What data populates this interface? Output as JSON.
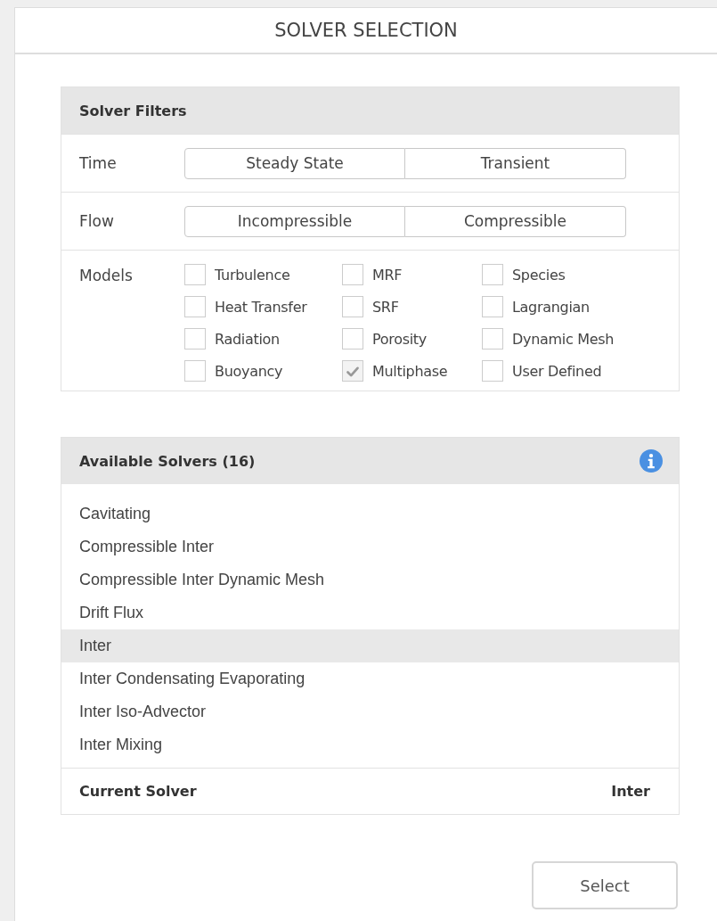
{
  "window": {
    "title": "SOLVER SELECTION"
  },
  "filters": {
    "title": "Solver Filters",
    "rows": [
      {
        "label": "Time",
        "options": [
          {
            "label": "Steady State",
            "selected": false
          },
          {
            "label": "Transient",
            "selected": false
          }
        ]
      },
      {
        "label": "Flow",
        "options": [
          {
            "label": "Incompressible",
            "selected": false
          },
          {
            "label": "Compressible",
            "selected": false
          }
        ]
      }
    ],
    "models": {
      "label": "Models",
      "items": [
        {
          "label": "Turbulence",
          "checked": false
        },
        {
          "label": "MRF",
          "checked": false
        },
        {
          "label": "Species",
          "checked": false
        },
        {
          "label": "Heat Transfer",
          "checked": false
        },
        {
          "label": "SRF",
          "checked": false
        },
        {
          "label": "Lagrangian",
          "checked": false
        },
        {
          "label": "Radiation",
          "checked": false
        },
        {
          "label": "Porosity",
          "checked": false
        },
        {
          "label": "Dynamic Mesh",
          "checked": false
        },
        {
          "label": "Buoyancy",
          "checked": false
        },
        {
          "label": "Multiphase",
          "checked": true
        },
        {
          "label": "User Defined",
          "checked": false
        }
      ]
    }
  },
  "solvers": {
    "title": "Available Solvers (16)",
    "items": [
      {
        "label": "Cavitating",
        "selected": false
      },
      {
        "label": "Compressible Inter",
        "selected": false
      },
      {
        "label": "Compressible Inter Dynamic Mesh",
        "selected": false
      },
      {
        "label": "Drift Flux",
        "selected": false
      },
      {
        "label": "Inter",
        "selected": true
      },
      {
        "label": "Inter Condensating Evaporating",
        "selected": false
      },
      {
        "label": "Inter Iso-Advector",
        "selected": false
      },
      {
        "label": "Inter Mixing",
        "selected": false
      }
    ],
    "current_label": "Current Solver",
    "current_value": "Inter"
  },
  "buttons": [
    "Select"
  ]
}
